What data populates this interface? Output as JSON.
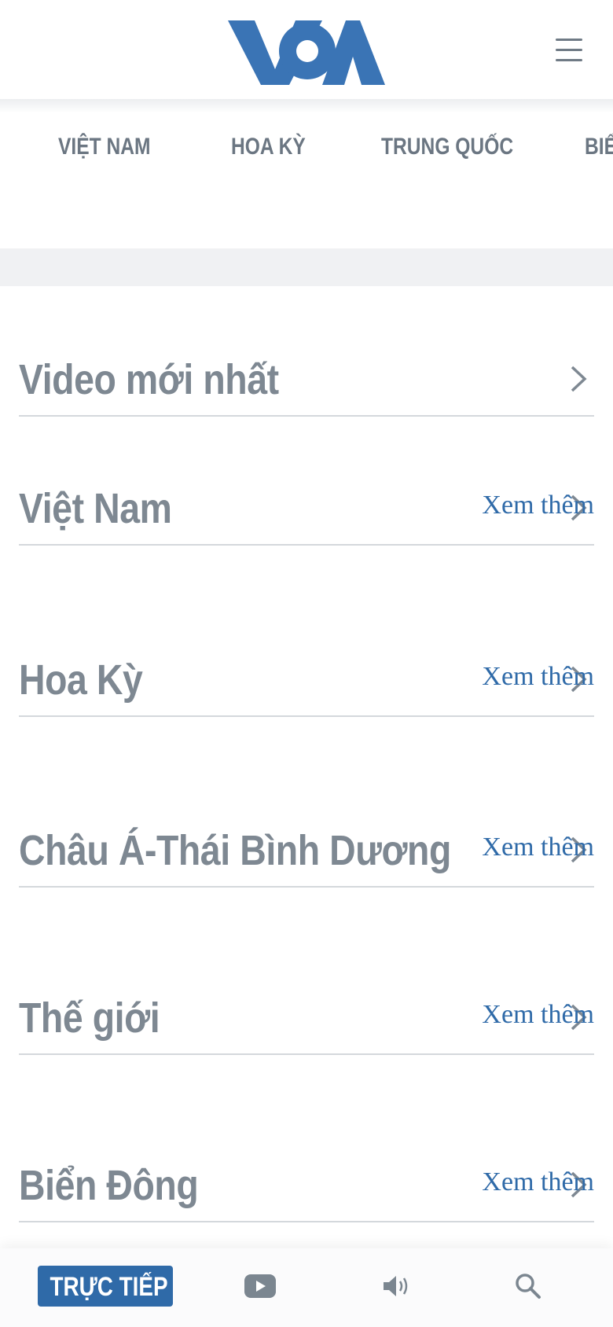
{
  "brand": {
    "name": "VOA",
    "color": "#3a74b5"
  },
  "header": {
    "menu_icon": "hamburger-menu-icon"
  },
  "nav": {
    "items": [
      {
        "label": "VIỆT NAM"
      },
      {
        "label": "HOA KỲ"
      },
      {
        "label": "TRUNG QUỐC"
      },
      {
        "label": "BIỂN ĐÔNG"
      }
    ]
  },
  "sections": [
    {
      "title": "Video mới nhất",
      "more": ""
    },
    {
      "title": "Việt Nam",
      "more": "Xem thêm"
    },
    {
      "title": "Hoa Kỳ",
      "more": "Xem thêm"
    },
    {
      "title": "Châu Á-Thái Bình Dương",
      "more": "Xem thêm"
    },
    {
      "title": "Thế giới",
      "more": "Xem thêm"
    },
    {
      "title": "Biển Đông",
      "more": "Xem thêm"
    }
  ],
  "bottom_bar": {
    "live_label": "TRỰC TIẾP",
    "icons": [
      "video-play-icon",
      "audio-speaker-icon",
      "search-icon"
    ],
    "accent": "#2f6aa8"
  }
}
